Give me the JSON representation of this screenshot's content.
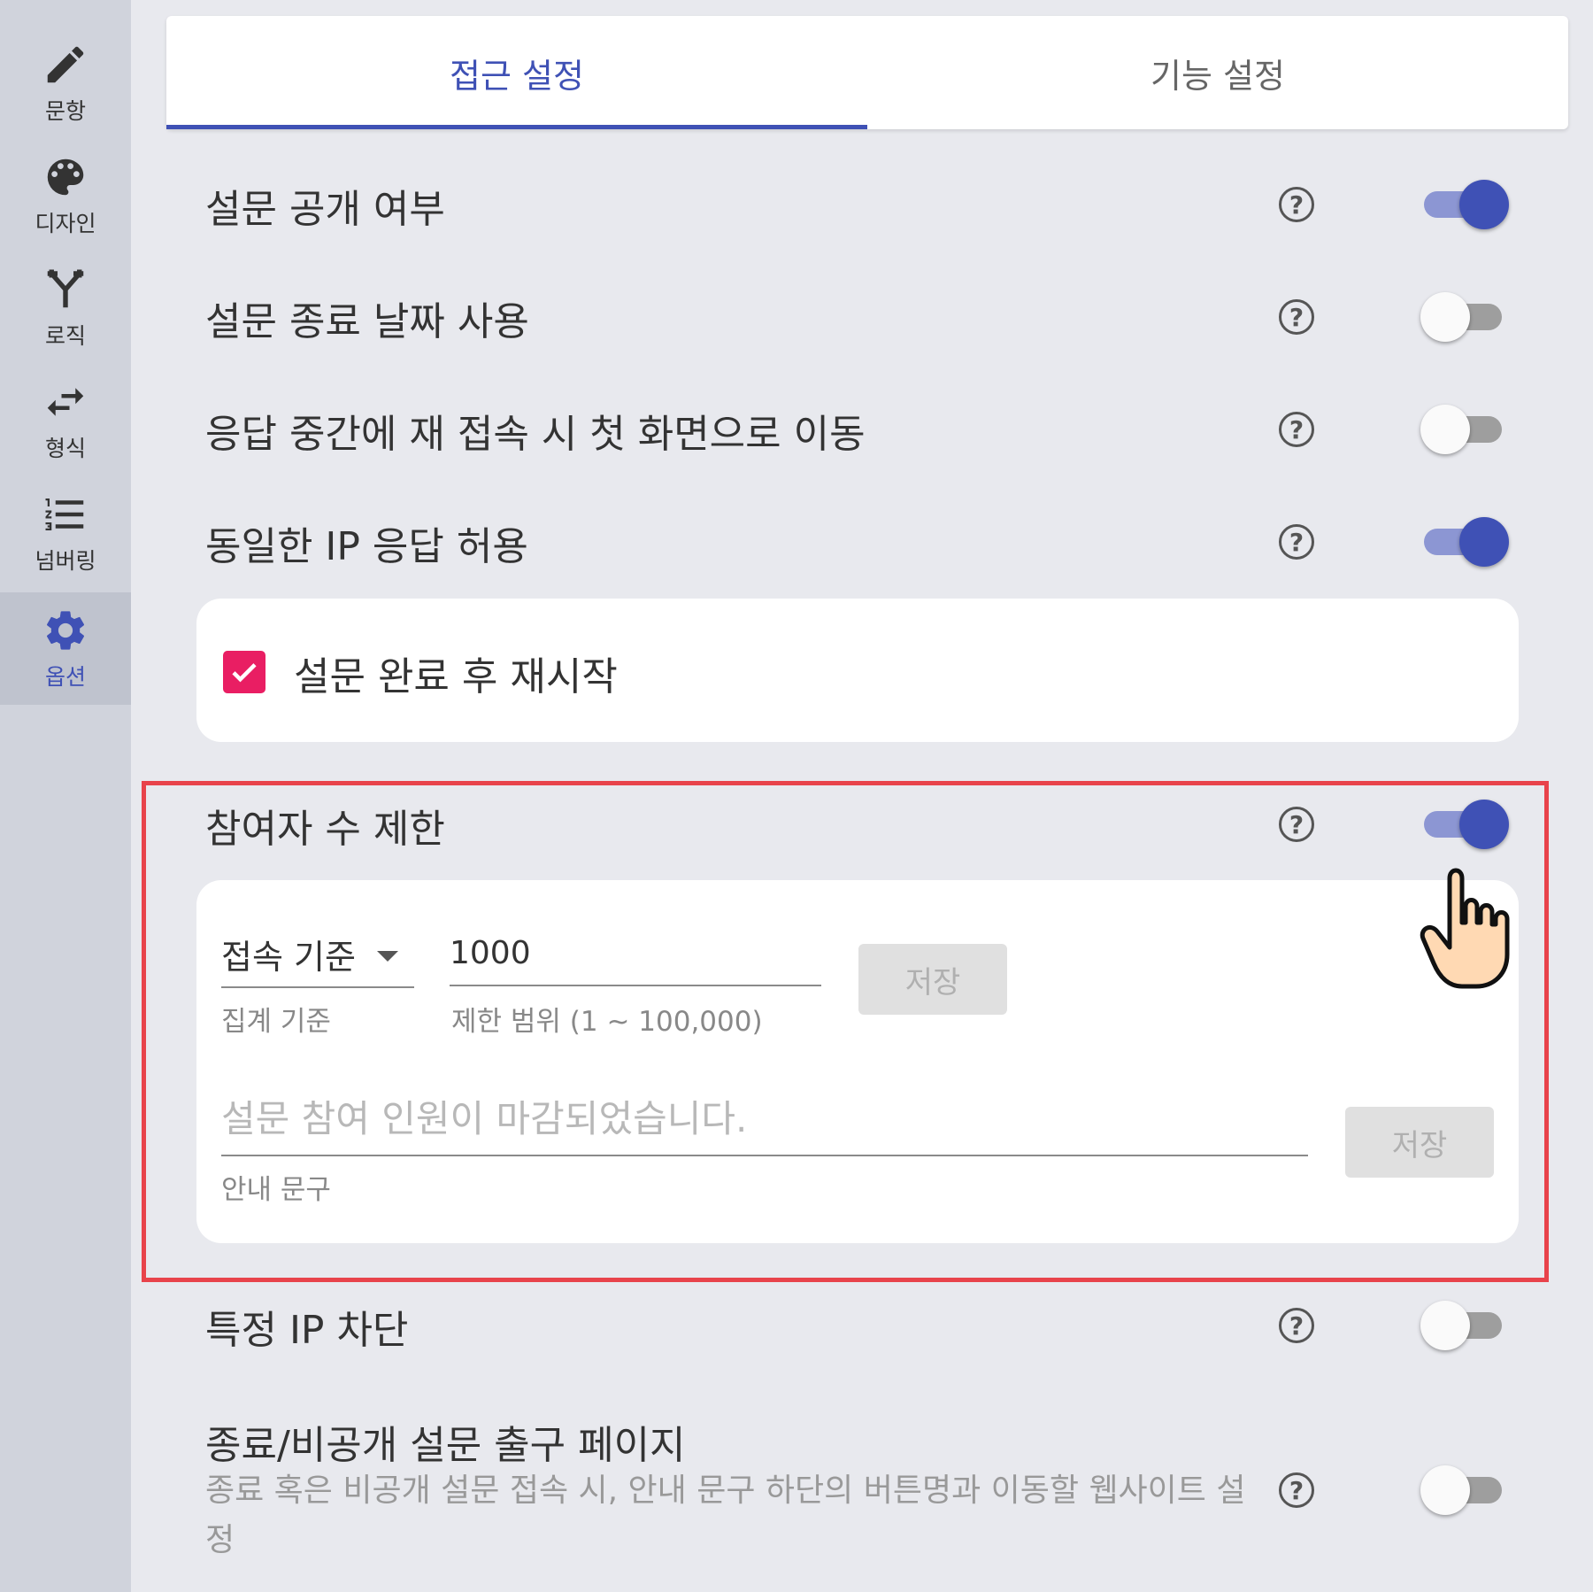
{
  "sidebar": {
    "items": [
      {
        "label": "문항",
        "icon": "pencil-icon"
      },
      {
        "label": "디자인",
        "icon": "palette-icon"
      },
      {
        "label": "로직",
        "icon": "branch-icon"
      },
      {
        "label": "형식",
        "icon": "swap-arrows-icon"
      },
      {
        "label": "넘버링",
        "icon": "numbered-list-icon"
      },
      {
        "label": "옵션",
        "icon": "gear-icon"
      }
    ],
    "active_index": 5
  },
  "tabs": [
    {
      "label": "접근 설정",
      "active": true
    },
    {
      "label": "기능 설정",
      "active": false
    }
  ],
  "settings": {
    "public": {
      "label": "설문 공개 여부",
      "on": true
    },
    "end_date": {
      "label": "설문 종료 날짜 사용",
      "on": false
    },
    "reconnect": {
      "label": "응답 중간에 재 접속 시 첫 화면으로 이동",
      "on": false
    },
    "same_ip": {
      "label": "동일한 IP 응답 허용",
      "on": true
    },
    "restart": {
      "label": "설문 완료 후 재시작",
      "checked": true
    },
    "limit": {
      "label": "참여자 수 제한",
      "on": true,
      "basis_value": "접속 기준",
      "basis_helper": "집계 기준",
      "count_value": "1000",
      "count_helper": "제한 범위 (1 ~ 100,000)",
      "save_label": "저장",
      "message_placeholder": "설문 참여 인원이 마감되었습니다.",
      "message_helper": "안내 문구",
      "message_save_label": "저장"
    },
    "block_ip": {
      "label": "특정 IP 차단",
      "on": false
    },
    "exit_page": {
      "label": "종료/비공개 설문 출구 페이지",
      "description": "종료 혹은 비공개 설문 접속 시, 안내 문구 하단의 버튼명과 이동할 웹사이트 설정",
      "on": false
    }
  },
  "help_glyph": "?",
  "colors": {
    "primary": "#3f51b5",
    "checkbox": "#e91e63",
    "highlight_border": "#e8434b",
    "background": "#e8e9ee",
    "sidebar": "#d0d3dc"
  }
}
